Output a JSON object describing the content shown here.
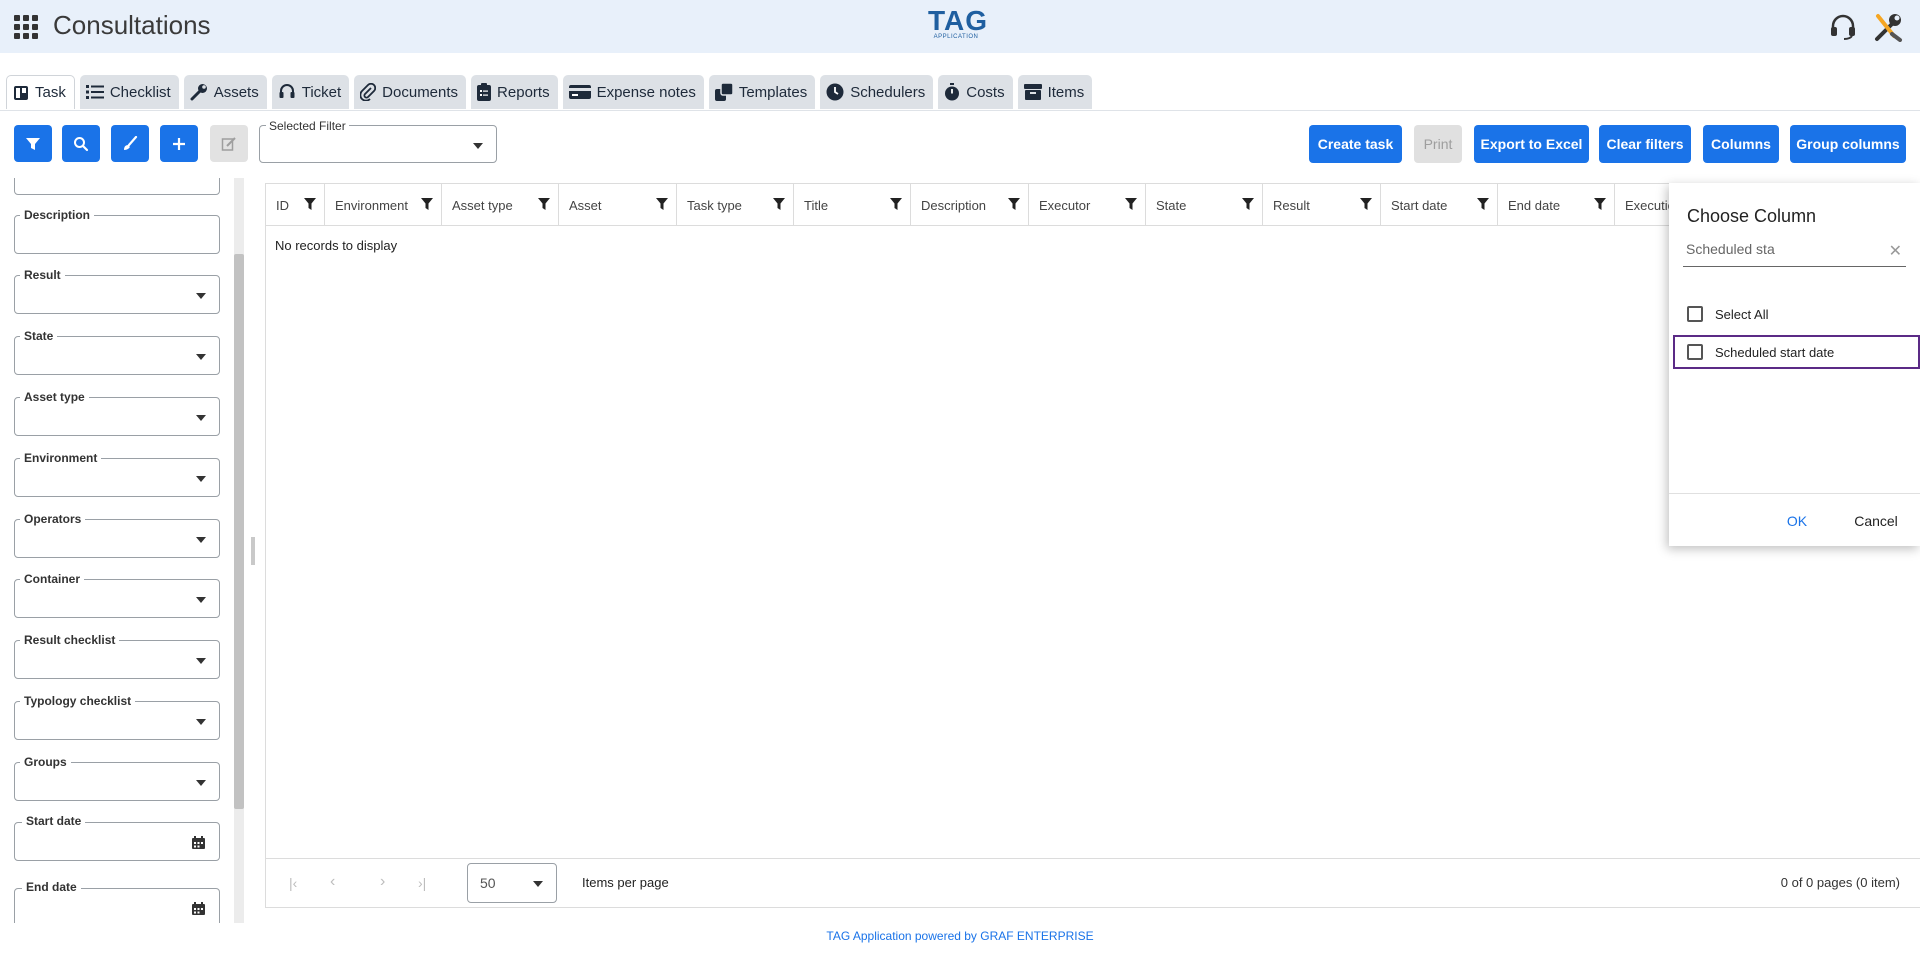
{
  "header": {
    "app_title": "Consultations",
    "logo_text": "TAG",
    "logo_subtext": "APPLICATION"
  },
  "tabs": [
    {
      "label": "Task",
      "icon": "board-icon",
      "active": true
    },
    {
      "label": "Checklist",
      "icon": "list-icon"
    },
    {
      "label": "Assets",
      "icon": "wrench-icon"
    },
    {
      "label": "Ticket",
      "icon": "headset-icon"
    },
    {
      "label": "Documents",
      "icon": "paperclip-icon"
    },
    {
      "label": "Reports",
      "icon": "clipboard-icon"
    },
    {
      "label": "Expense notes",
      "icon": "card-icon"
    },
    {
      "label": "Templates",
      "icon": "copy-icon"
    },
    {
      "label": "Schedulers",
      "icon": "clock-icon"
    },
    {
      "label": "Costs",
      "icon": "stopwatch-icon"
    },
    {
      "label": "Items",
      "icon": "box-icon"
    }
  ],
  "toolbar": {
    "selected_filter_label": "Selected Filter",
    "selected_filter_value": "",
    "create_task": "Create task",
    "print": "Print",
    "export_excel": "Export to Excel",
    "clear_filters": "Clear filters",
    "columns": "Columns",
    "group_columns": "Group columns"
  },
  "filters": [
    {
      "label": "Description",
      "type": "text"
    },
    {
      "label": "Result",
      "type": "select"
    },
    {
      "label": "State",
      "type": "select"
    },
    {
      "label": "Asset type",
      "type": "select"
    },
    {
      "label": "Environment",
      "type": "select"
    },
    {
      "label": "Operators",
      "type": "select"
    },
    {
      "label": "Container",
      "type": "select"
    },
    {
      "label": "Result checklist",
      "type": "select"
    },
    {
      "label": "Typology checklist",
      "type": "select"
    },
    {
      "label": "Groups",
      "type": "select"
    },
    {
      "label": "Start date",
      "type": "date"
    },
    {
      "label": "End date",
      "type": "date"
    }
  ],
  "grid": {
    "columns": [
      "ID",
      "Environment",
      "Asset type",
      "Asset",
      "Task type",
      "Title",
      "Description",
      "Executor",
      "State",
      "Result",
      "Start date",
      "End date",
      "Executio"
    ],
    "empty_message": "No records to display",
    "page_size": "50",
    "items_per_page": "Items per page",
    "page_info": "0 of 0 pages (0 item)"
  },
  "chooser": {
    "title": "Choose Column",
    "search_value": "Scheduled sta",
    "select_all": "Select All",
    "options": [
      "Scheduled start date"
    ],
    "ok": "OK",
    "cancel": "Cancel"
  },
  "footer": "TAG Application powered by GRAF ENTERPRISE",
  "colors": {
    "primary": "#1a73e8",
    "header_bg": "#e8f0fa",
    "highlight": "#5b2a86"
  }
}
